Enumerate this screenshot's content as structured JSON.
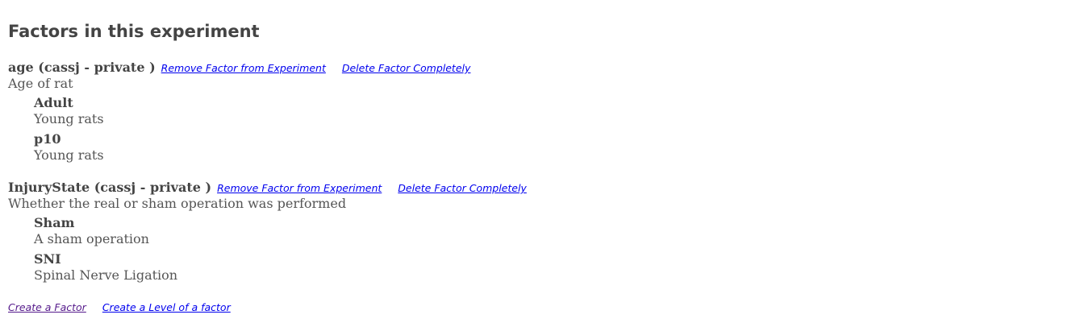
{
  "page": {
    "title": "Factors in this experiment"
  },
  "factors": [
    {
      "name": "age (cassj - private )",
      "remove_label": "Remove Factor from Experiment",
      "delete_label": "Delete Factor Completely",
      "description": "Age of rat",
      "levels": [
        {
          "name": "Adult",
          "description": "Young rats"
        },
        {
          "name": "p10",
          "description": "Young rats"
        }
      ]
    },
    {
      "name": "InjuryState (cassj - private )",
      "remove_label": "Remove Factor from Experiment",
      "delete_label": "Delete Factor Completely",
      "description": "Whether the real or sham operation was performed",
      "levels": [
        {
          "name": "Sham",
          "description": "A sham operation"
        },
        {
          "name": "SNI",
          "description": "Spinal Nerve Ligation"
        }
      ]
    }
  ],
  "footer": {
    "create_factor_label": "Create a Factor",
    "create_level_label": "Create a Level of a factor"
  },
  "colors": {
    "link": "#0000ee",
    "visited_link": "#551a8b",
    "text": "#444444"
  }
}
